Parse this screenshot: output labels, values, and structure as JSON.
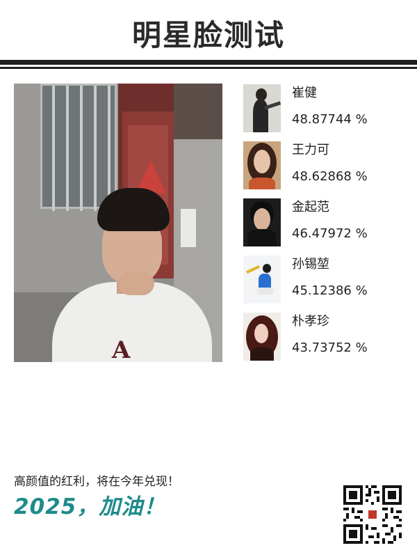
{
  "header": {
    "title": "明星脸测试"
  },
  "matches": [
    {
      "name": "崔健",
      "score": "48.87744 %"
    },
    {
      "name": "王力可",
      "score": "48.62868 %"
    },
    {
      "name": "金起范",
      "score": "46.47972 %"
    },
    {
      "name": "孙锡堃",
      "score": "45.12386 %"
    },
    {
      "name": "朴孝珍",
      "score": "43.73752 %"
    }
  ],
  "footer": {
    "slogan": "高颜值的红利，将在今年兑现！",
    "cheer": "2025，加油！"
  },
  "colors": {
    "accent": "#1e8b8b",
    "text": "#222222",
    "rule": "#1f1f1f"
  }
}
